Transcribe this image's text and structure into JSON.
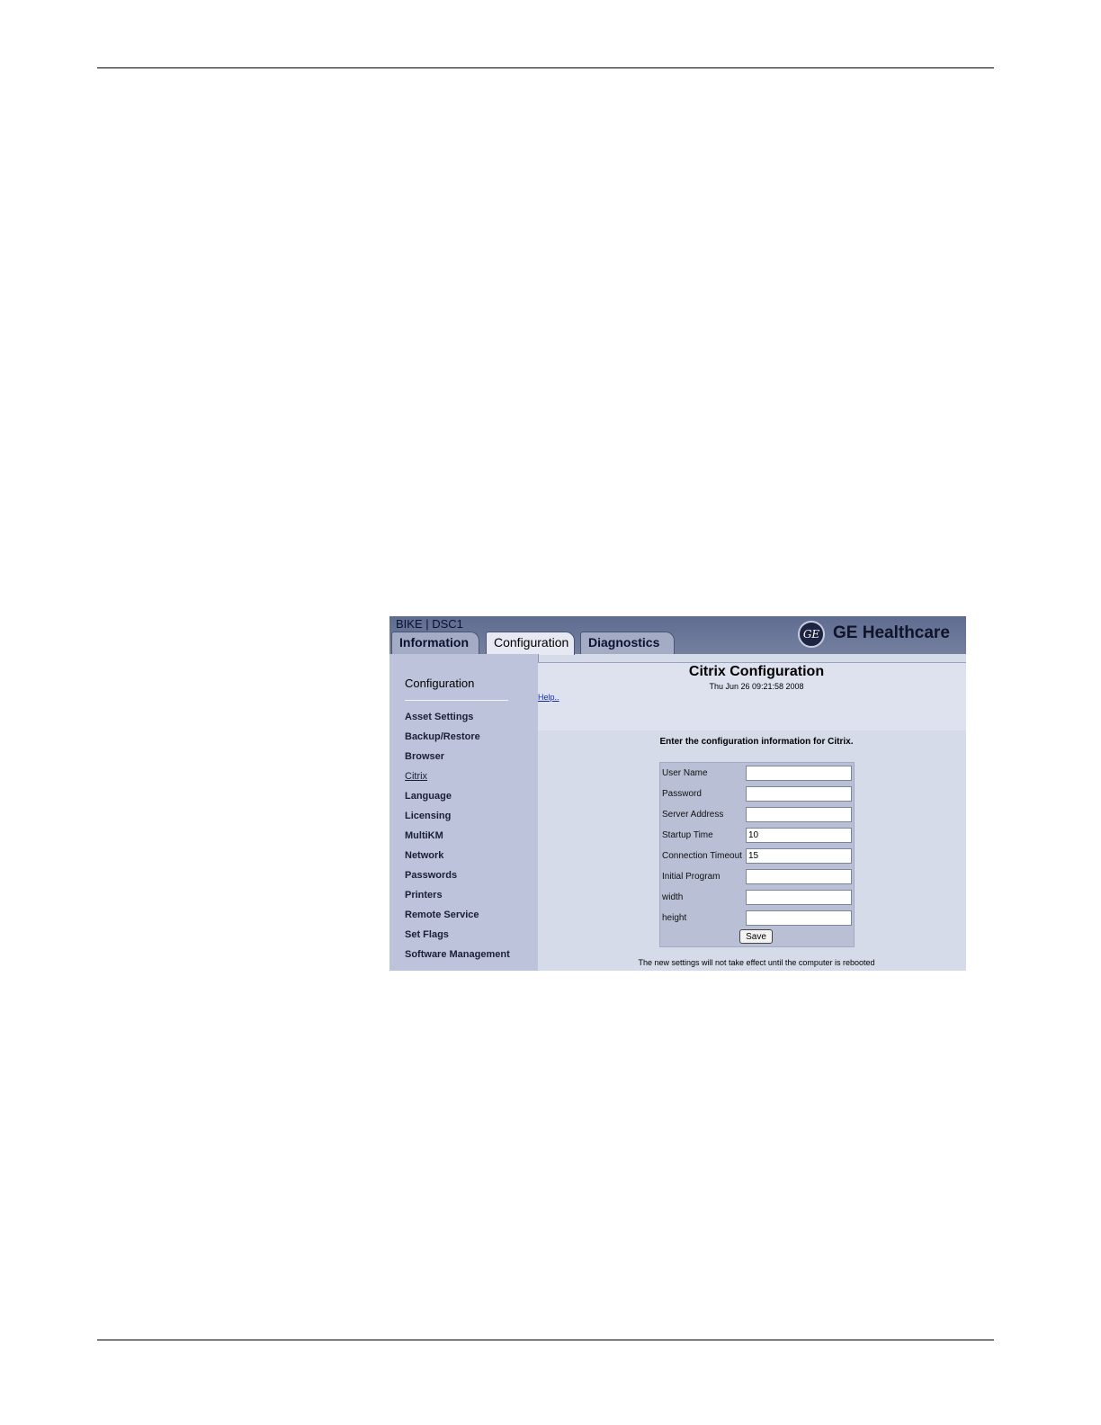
{
  "app": {
    "device_title": "BIKE | DSC1",
    "brand": "GE Healthcare",
    "logo_text": "GE"
  },
  "tabs": [
    {
      "label": "Information",
      "selected": false
    },
    {
      "label": "Configuration",
      "selected": true
    },
    {
      "label": "Diagnostics",
      "selected": false
    }
  ],
  "sidebar": {
    "title": "Configuration",
    "items": [
      {
        "label": "Asset Settings"
      },
      {
        "label": "Backup/Restore"
      },
      {
        "label": "Browser"
      },
      {
        "label": "Citrix",
        "active": true
      },
      {
        "label": "Language"
      },
      {
        "label": "Licensing"
      },
      {
        "label": "MultiKM"
      },
      {
        "label": "Network"
      },
      {
        "label": "Passwords"
      },
      {
        "label": "Printers"
      },
      {
        "label": "Remote Service"
      },
      {
        "label": "Set Flags"
      },
      {
        "label": "Software Management"
      }
    ]
  },
  "content": {
    "title": "Citrix Configuration",
    "date": "Thu Jun 26 09:21:58 2008",
    "help_link": "Help..",
    "instruction": "Enter the configuration information for Citrix.",
    "fields": [
      {
        "label": "User Name",
        "value": ""
      },
      {
        "label": "Password",
        "value": ""
      },
      {
        "label": "Server Address",
        "value": ""
      },
      {
        "label": "Startup Time",
        "value": "10"
      },
      {
        "label": "Connection Timeout",
        "value": "15"
      },
      {
        "label": "Initial Program",
        "value": ""
      },
      {
        "label": "width",
        "value": ""
      },
      {
        "label": "height",
        "value": ""
      }
    ],
    "save_label": "Save",
    "notice": "The new settings will not take effect until the computer is rebooted"
  },
  "colors": {
    "header": "#6a7698",
    "sidebar": "#bcc3da",
    "content": "#d6dbe9",
    "link": "#1b2bb0"
  }
}
